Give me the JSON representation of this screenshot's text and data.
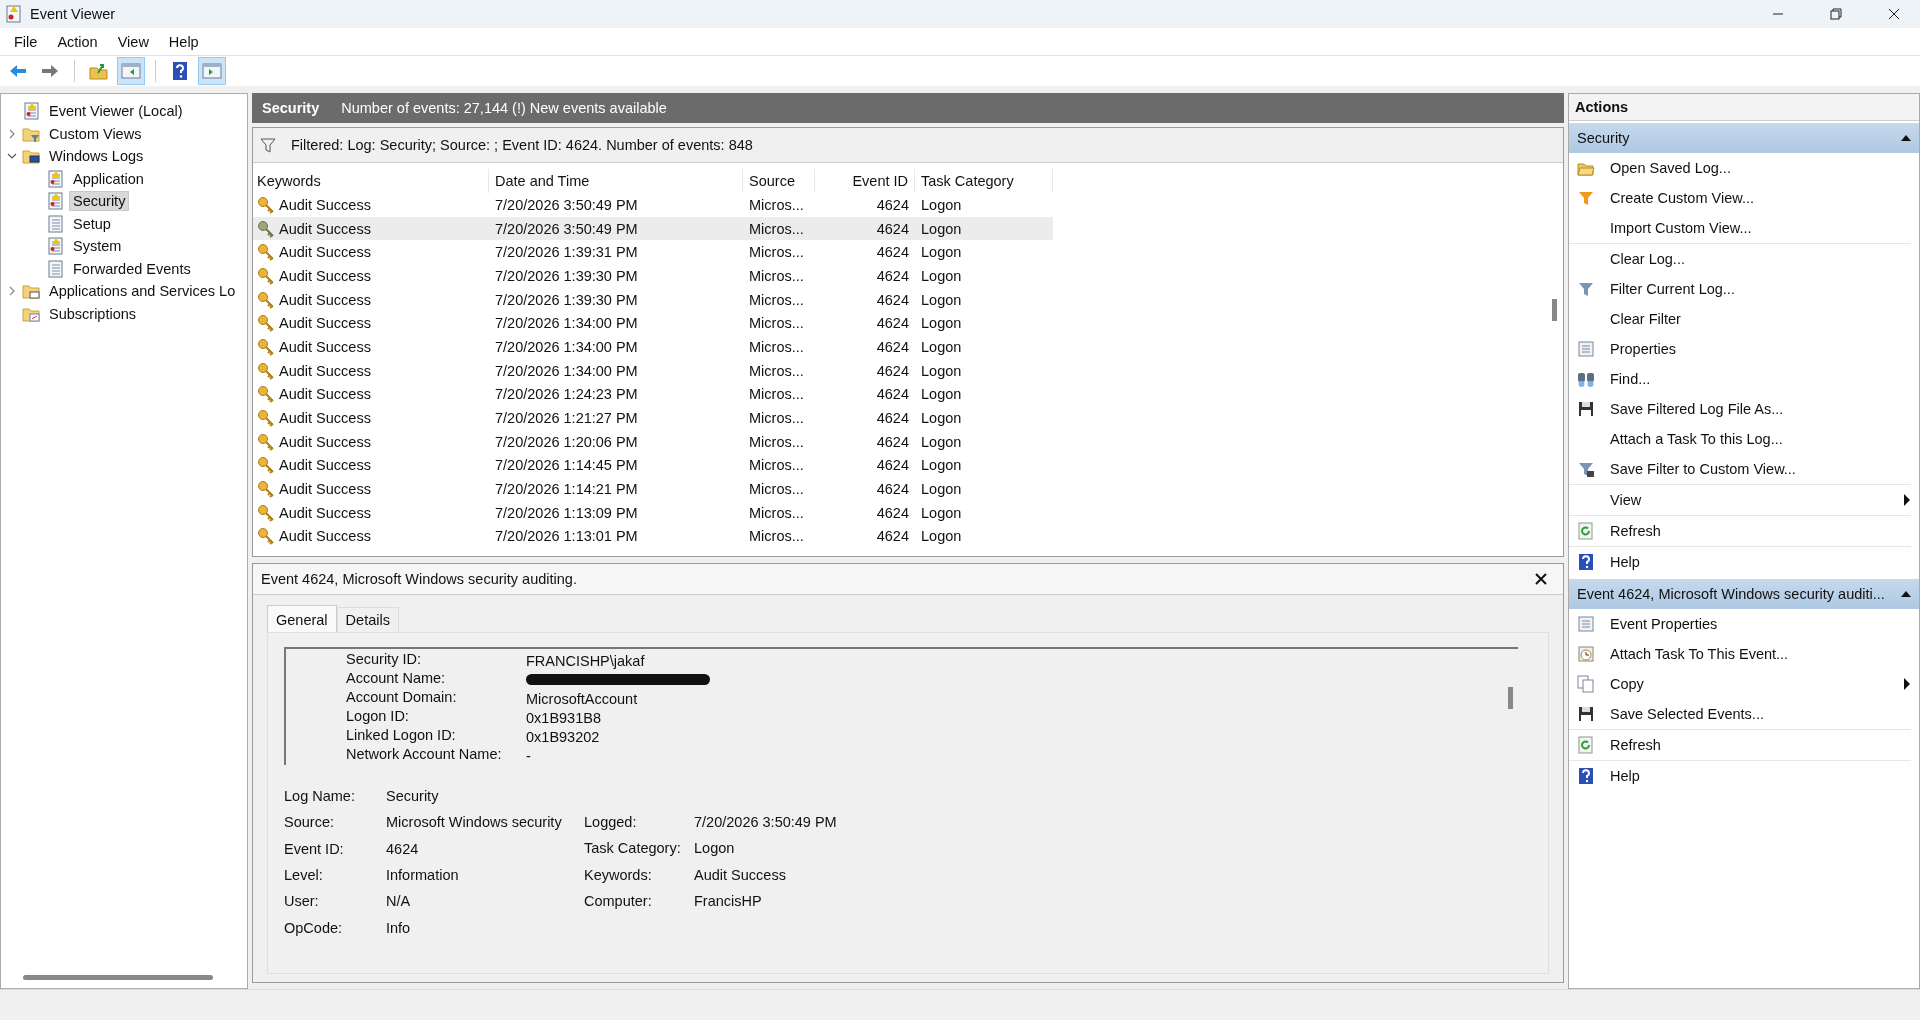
{
  "window": {
    "title": "Event Viewer"
  },
  "menu": [
    "File",
    "Action",
    "View",
    "Help"
  ],
  "toolbar": [
    {
      "kind": "back"
    },
    {
      "kind": "forward"
    },
    {
      "kind": "up-folder"
    },
    {
      "kind": "show-tree",
      "selected": true
    },
    {
      "kind": "help"
    },
    {
      "kind": "show-actions",
      "selected": true
    }
  ],
  "tree": [
    {
      "label": "Event Viewer (Local)",
      "kind": "root",
      "selected": false,
      "children": [
        {
          "label": "Custom Views",
          "kind": "folder-filter",
          "expanded": false,
          "selected": false
        },
        {
          "label": "Windows Logs",
          "kind": "folder-monitor",
          "expanded": true,
          "selected": false,
          "children": [
            {
              "label": "Application",
              "kind": "log-warn",
              "selected": false
            },
            {
              "label": "Security",
              "kind": "log-warn",
              "selected": true
            },
            {
              "label": "Setup",
              "kind": "log",
              "selected": false
            },
            {
              "label": "System",
              "kind": "log-warn",
              "selected": false
            },
            {
              "label": "Forwarded Events",
              "kind": "log",
              "selected": false
            }
          ]
        },
        {
          "label": "Applications and Services Lo",
          "kind": "folder-app",
          "expanded": false,
          "selected": false
        },
        {
          "label": "Subscriptions",
          "kind": "folder-sub",
          "selected": false
        }
      ]
    }
  ],
  "log_header": {
    "title": "Security",
    "info": "Number of events: 27,144 (!) New events available"
  },
  "filter_bar": {
    "text": "Filtered: Log: Security; Source: ; Event ID: 4624. Number of events: 848"
  },
  "table": {
    "columns": [
      "Keywords",
      "Date and Time",
      "Source",
      "Event ID",
      "Task Category"
    ],
    "rows": [
      {
        "cells": [
          "Audit Success",
          "7/20/2026 3:50:49 PM",
          "Micros...",
          "4624",
          "Logon"
        ],
        "selected": false
      },
      {
        "cells": [
          "Audit Success",
          "7/20/2026 3:50:49 PM",
          "Micros...",
          "4624",
          "Logon"
        ],
        "selected": true
      },
      {
        "cells": [
          "Audit Success",
          "7/20/2026 1:39:31 PM",
          "Micros...",
          "4624",
          "Logon"
        ],
        "selected": false
      },
      {
        "cells": [
          "Audit Success",
          "7/20/2026 1:39:30 PM",
          "Micros...",
          "4624",
          "Logon"
        ],
        "selected": false
      },
      {
        "cells": [
          "Audit Success",
          "7/20/2026 1:39:30 PM",
          "Micros...",
          "4624",
          "Logon"
        ],
        "selected": false
      },
      {
        "cells": [
          "Audit Success",
          "7/20/2026 1:34:00 PM",
          "Micros...",
          "4624",
          "Logon"
        ],
        "selected": false
      },
      {
        "cells": [
          "Audit Success",
          "7/20/2026 1:34:00 PM",
          "Micros...",
          "4624",
          "Logon"
        ],
        "selected": false
      },
      {
        "cells": [
          "Audit Success",
          "7/20/2026 1:34:00 PM",
          "Micros...",
          "4624",
          "Logon"
        ],
        "selected": false
      },
      {
        "cells": [
          "Audit Success",
          "7/20/2026 1:24:23 PM",
          "Micros...",
          "4624",
          "Logon"
        ],
        "selected": false
      },
      {
        "cells": [
          "Audit Success",
          "7/20/2026 1:21:27 PM",
          "Micros...",
          "4624",
          "Logon"
        ],
        "selected": false
      },
      {
        "cells": [
          "Audit Success",
          "7/20/2026 1:20:06 PM",
          "Micros...",
          "4624",
          "Logon"
        ],
        "selected": false
      },
      {
        "cells": [
          "Audit Success",
          "7/20/2026 1:14:45 PM",
          "Micros...",
          "4624",
          "Logon"
        ],
        "selected": false
      },
      {
        "cells": [
          "Audit Success",
          "7/20/2026 1:14:21 PM",
          "Micros...",
          "4624",
          "Logon"
        ],
        "selected": false
      },
      {
        "cells": [
          "Audit Success",
          "7/20/2026 1:13:09 PM",
          "Micros...",
          "4624",
          "Logon"
        ],
        "selected": false
      },
      {
        "cells": [
          "Audit Success",
          "7/20/2026 1:13:01 PM",
          "Micros...",
          "4624",
          "Logon"
        ],
        "selected": false
      }
    ]
  },
  "detail": {
    "title": "Event 4624, Microsoft Windows security auditing.",
    "tabs": [
      {
        "label": "General",
        "selected": true
      },
      {
        "label": "Details",
        "selected": false
      }
    ],
    "description": [
      {
        "label": "Security ID:",
        "value": "FRANCISHP\\jakaf"
      },
      {
        "label": "Account Name:",
        "redacted": true
      },
      {
        "label": "Account Domain:",
        "value": "MicrosoftAccount"
      },
      {
        "label": "Logon ID:",
        "value": "0x1B931B8"
      },
      {
        "label": "Linked Logon ID:",
        "value": "0x1B93202"
      },
      {
        "label": "Network Account Name:",
        "value": "-"
      }
    ],
    "fields_left": [
      {
        "label": "Log Name:",
        "value": "Security"
      },
      {
        "label": "Source:",
        "value": "Microsoft Windows security"
      },
      {
        "label": "Event ID:",
        "value": "4624"
      },
      {
        "label": "Level:",
        "value": "Information"
      },
      {
        "label": "User:",
        "value": "N/A"
      },
      {
        "label": "OpCode:",
        "value": "Info"
      }
    ],
    "fields_right": [
      {
        "label": "Logged:",
        "value": "7/20/2026 3:50:49 PM"
      },
      {
        "label": "Task Category:",
        "value": "Logon"
      },
      {
        "label": "Keywords:",
        "value": "Audit Success"
      },
      {
        "label": "Computer:",
        "value": "FrancisHP"
      }
    ]
  },
  "actions": {
    "title": "Actions",
    "sections": [
      {
        "title": "Security",
        "expanded": true,
        "items": [
          {
            "label": "Open Saved Log...",
            "kind": "open"
          },
          {
            "label": "Create Custom View...",
            "kind": "funnel-star"
          },
          {
            "label": "Import Custom View...",
            "kind": "plain",
            "separated": true
          },
          {
            "label": "Clear Log...",
            "kind": "plain"
          },
          {
            "label": "Filter Current Log...",
            "kind": "funnel"
          },
          {
            "label": "Clear Filter",
            "kind": "plain"
          },
          {
            "label": "Properties",
            "kind": "properties"
          },
          {
            "label": "Find...",
            "kind": "binoculars"
          },
          {
            "label": "Save Filtered Log File As...",
            "kind": "floppy"
          },
          {
            "label": "Attach a Task To this Log...",
            "kind": "plain"
          },
          {
            "label": "Save Filter to Custom View...",
            "kind": "funnel-save",
            "separated": true
          },
          {
            "label": "View",
            "kind": "plain",
            "submenu": true,
            "separated": true
          },
          {
            "label": "Refresh",
            "kind": "refresh",
            "separated": true
          },
          {
            "label": "Help",
            "kind": "help"
          }
        ]
      },
      {
        "title": "Event 4624, Microsoft Windows security auditi...",
        "expanded": true,
        "items": [
          {
            "label": "Event Properties",
            "kind": "properties"
          },
          {
            "label": "Attach Task To This Event...",
            "kind": "clock"
          },
          {
            "label": "Copy",
            "kind": "copy",
            "submenu": true
          },
          {
            "label": "Save Selected Events...",
            "kind": "floppy",
            "separated": true
          },
          {
            "label": "Refresh",
            "kind": "refresh",
            "separated": true
          },
          {
            "label": "Help",
            "kind": "help"
          }
        ]
      }
    ]
  }
}
